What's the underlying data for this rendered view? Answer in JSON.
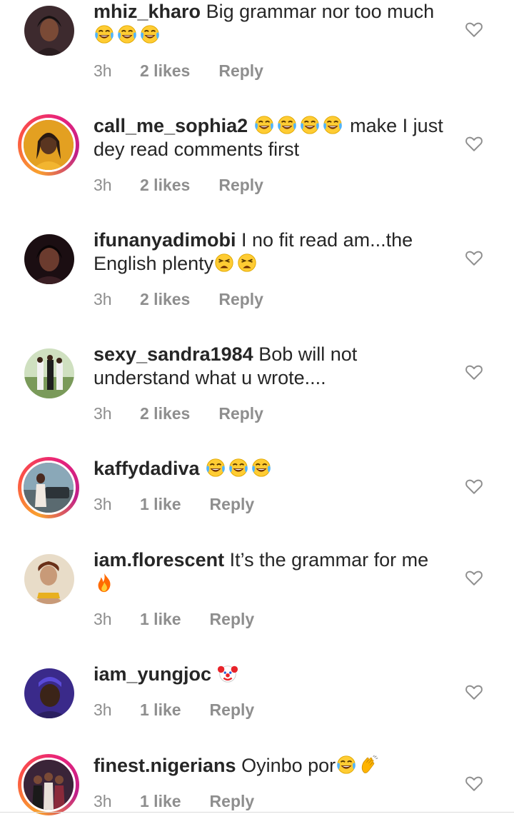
{
  "comments": [
    {
      "username": "mhiz_kharo",
      "text": "Big grammar nor too much",
      "emojis_after": [
        "laughing-tears",
        "laughing-tears",
        "laughing-tears"
      ],
      "time": "3h",
      "likes": "2 likes",
      "reply": "Reply",
      "story": false
    },
    {
      "username": "call_me_sophia2",
      "text_before_emoji": "",
      "text": "make I just dey read comments first",
      "emojis_before": [
        "laughing-tears",
        "laughing-tears",
        "laughing-tears",
        "laughing-tears"
      ],
      "time": "3h",
      "likes": "2 likes",
      "reply": "Reply",
      "story": true
    },
    {
      "username": "ifunanyadimobi",
      "text": "I no fit read am...the English plenty",
      "emojis_after": [
        "weary-face",
        "weary-face"
      ],
      "time": "3h",
      "likes": "2 likes",
      "reply": "Reply",
      "story": false
    },
    {
      "username": "sexy_sandra1984",
      "text": "Bob will not understand what u wrote....",
      "time": "3h",
      "likes": "2 likes",
      "reply": "Reply",
      "story": false
    },
    {
      "username": "kaffydadiva",
      "text": "",
      "emojis_after": [
        "laughing-tears",
        "laughing-tears",
        "laughing-tears"
      ],
      "time": "3h",
      "likes": "1 like",
      "reply": "Reply",
      "story": true
    },
    {
      "username": "iam.florescent",
      "text": "It’s the grammar for me",
      "emojis_after": [
        "fire"
      ],
      "time": "3h",
      "likes": "1 like",
      "reply": "Reply",
      "story": false
    },
    {
      "username": "iam_yungjoc",
      "text": "",
      "emojis_after": [
        "clown-face"
      ],
      "time": "3h",
      "likes": "1 like",
      "reply": "Reply",
      "story": false
    },
    {
      "username": "finest.nigerians",
      "text": "Oyinbo por",
      "emojis_after": [
        "laughing-tears",
        "clapping-hands"
      ],
      "time": "3h",
      "likes": "1 like",
      "reply": "Reply",
      "story": true
    }
  ],
  "colors": {
    "text": "#262626",
    "meta": "#8e8e8e",
    "heart_stroke": "#8e8e8e",
    "story_ring_start": "#f9a12e",
    "story_ring_end": "#c01f8a"
  }
}
